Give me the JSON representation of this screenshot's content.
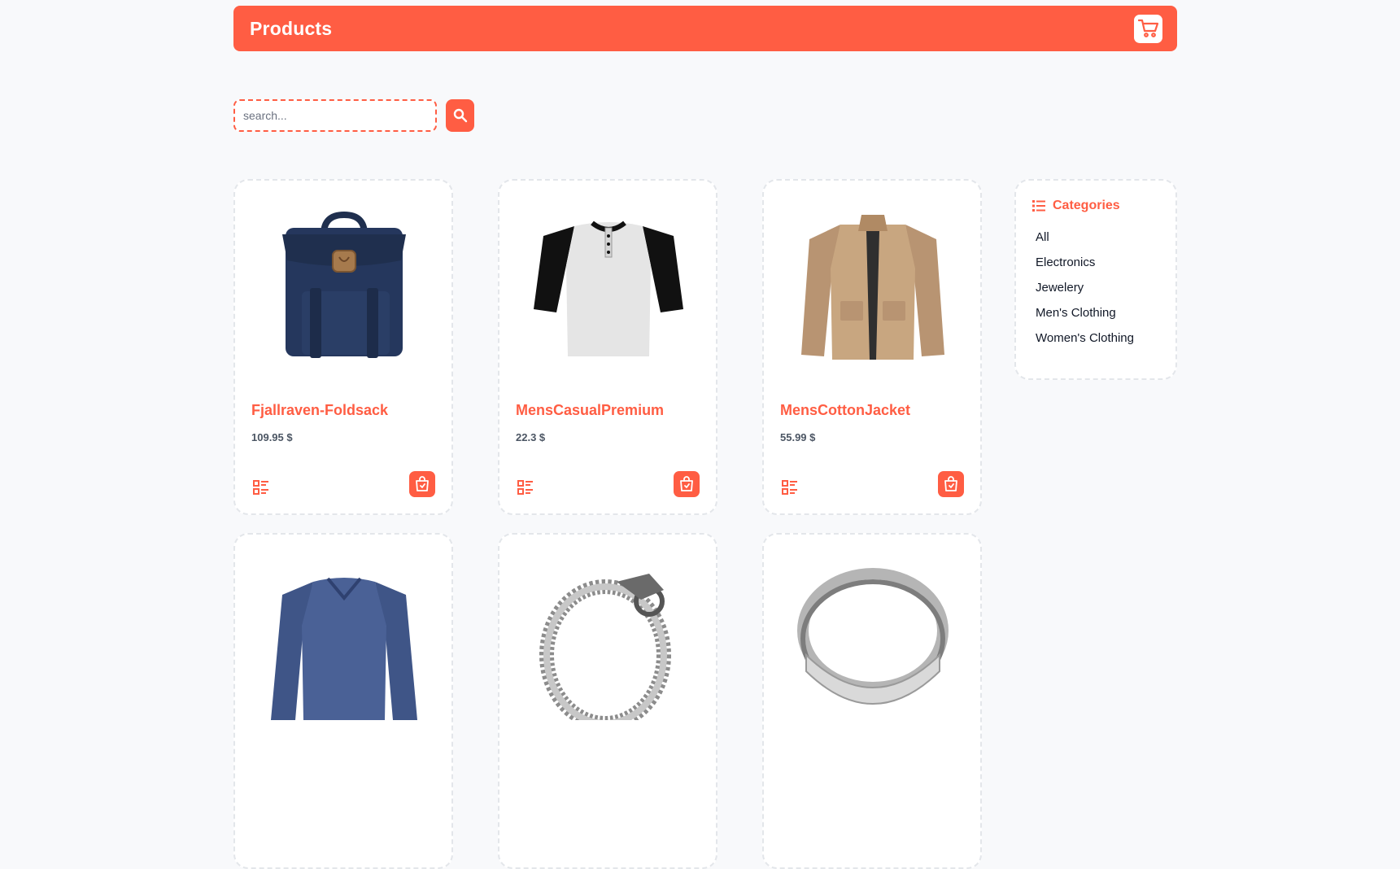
{
  "header": {
    "title": "Products"
  },
  "search": {
    "placeholder": "search..."
  },
  "products": [
    {
      "title": "Fjallraven-Foldsack",
      "price": "109.95 $",
      "image": "backpack"
    },
    {
      "title": "MensCasualPremium",
      "price": "22.3 $",
      "image": "raglan-tshirt"
    },
    {
      "title": "MensCottonJacket",
      "price": "55.99 $",
      "image": "cotton-jacket"
    },
    {
      "title": "",
      "price": "",
      "image": "long-sleeve-shirt"
    },
    {
      "title": "",
      "price": "",
      "image": "dragon-bracelet"
    },
    {
      "title": "",
      "price": "",
      "image": "silver-ring"
    }
  ],
  "categories": {
    "heading": "Categories",
    "items": [
      "All",
      "Electronics",
      "Jewelery",
      "Men's Clothing",
      "Women's Clothing"
    ]
  },
  "colors": {
    "accent": "#ff5d43",
    "background": "#f8f9fb",
    "card_border": "#e3e6ea"
  }
}
